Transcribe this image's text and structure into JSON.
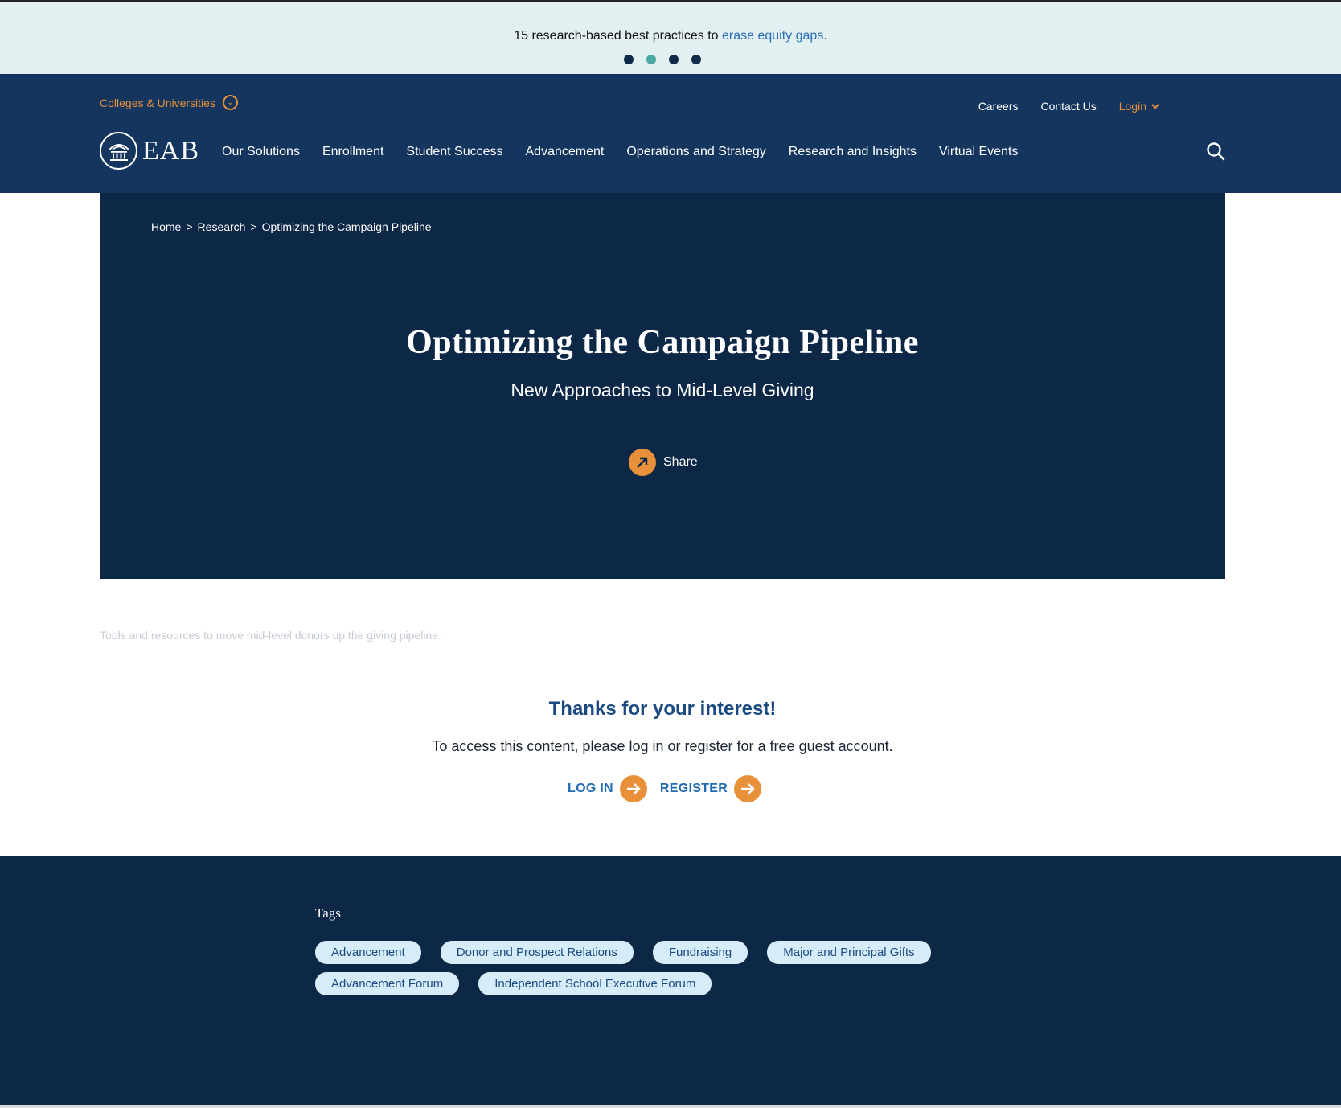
{
  "promo": {
    "text": "15 research-based best practices to ",
    "link": "erase equity gaps",
    "suffix": ".",
    "slides": 4,
    "active_slide": 2
  },
  "header": {
    "segment": "Colleges & Universities",
    "utility": {
      "careers": "Careers",
      "contact": "Contact Us",
      "login": "Login"
    },
    "logo": "EAB",
    "nav": [
      "Our Solutions",
      "Enrollment",
      "Student Success",
      "Advancement",
      "Operations and Strategy",
      "Research and Insights",
      "Virtual Events"
    ]
  },
  "breadcrumb": {
    "home": "Home",
    "sep": ">",
    "research": "Research",
    "current": "Optimizing the Campaign Pipeline"
  },
  "hero": {
    "title": "Optimizing the Campaign Pipeline",
    "subtitle": "New Approaches to Mid-Level Giving",
    "share": "Share"
  },
  "content": {
    "teaser": "Tools and resources to move mid-level donors up the giving pipeline.",
    "thanks_title": "Thanks for your interest!",
    "thanks_text": "To access this content, please log in or register for a free guest account.",
    "login_label": "LOG IN",
    "register_label": "REGISTER"
  },
  "footer": {
    "tags_label": "Tags",
    "tags": [
      "Advancement",
      "Donor and Prospect Relations",
      "Fundraising",
      "Major and Principal Gifts",
      "Advancement Forum",
      "Independent School Executive Forum"
    ]
  },
  "colors": {
    "navy": "#14355d",
    "hero_navy": "#0d2746",
    "orange": "#e9913a",
    "promo_bg": "#e3f0f1",
    "tag_bg": "#d7ecf9",
    "link_blue": "#1f6ab3"
  }
}
